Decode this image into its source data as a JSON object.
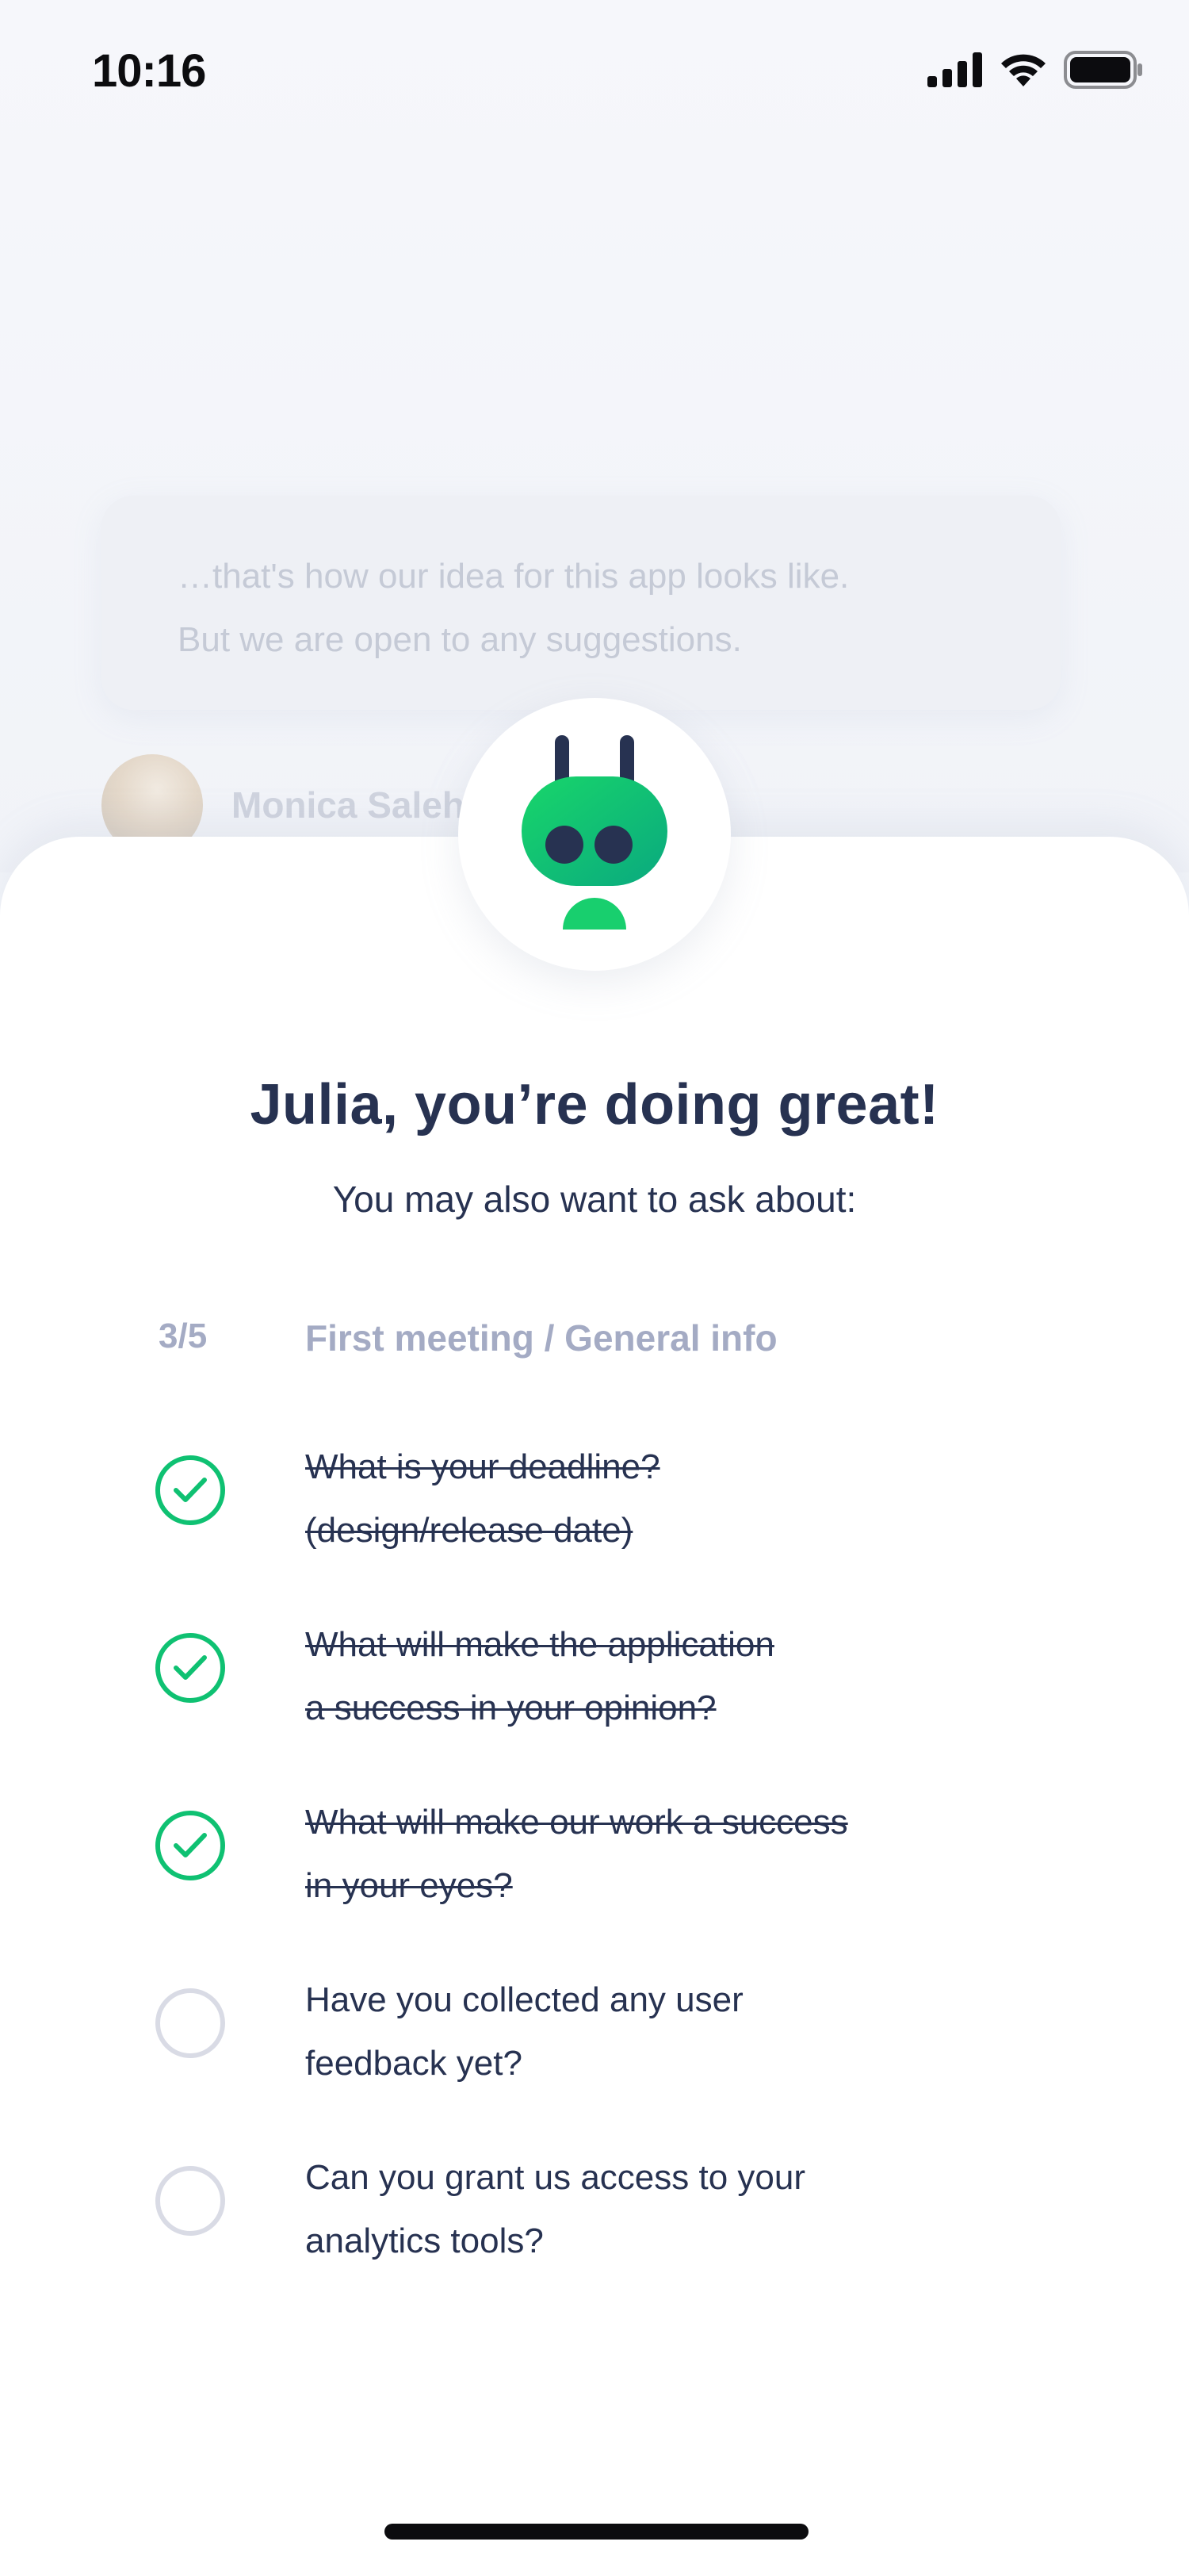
{
  "status_bar": {
    "time": "10:16",
    "icons": [
      "signal-icon",
      "wifi-icon",
      "battery-icon"
    ]
  },
  "background_chat": {
    "message_lines": [
      "…that's how our idea for this app looks like.",
      "But we are open to any suggestions."
    ],
    "author_name": "Monica Saleh"
  },
  "sheet": {
    "mascot_icon": "robot-mascot-icon",
    "title": "Julia, you’re doing great!",
    "subtitle": "You may also want to ask about:",
    "progress": "3/5",
    "section_title": "First meeting / General info",
    "questions": [
      {
        "lines": [
          "What is your deadline?",
          "(design/release date)"
        ],
        "done": true
      },
      {
        "lines": [
          "What will make the application",
          "a success in your opinion?"
        ],
        "done": true
      },
      {
        "lines": [
          "What will make our work a success",
          "in your eyes?"
        ],
        "done": true
      },
      {
        "lines": [
          "Have you collected any user",
          "feedback yet?"
        ],
        "done": false
      },
      {
        "lines": [
          "Can you grant us access to your",
          "analytics tools?"
        ],
        "done": false
      }
    ]
  },
  "colors": {
    "accent": "#0fc172",
    "text": "#273251",
    "muted": "#a4abc4",
    "unchecked": "#d9dbe5"
  }
}
